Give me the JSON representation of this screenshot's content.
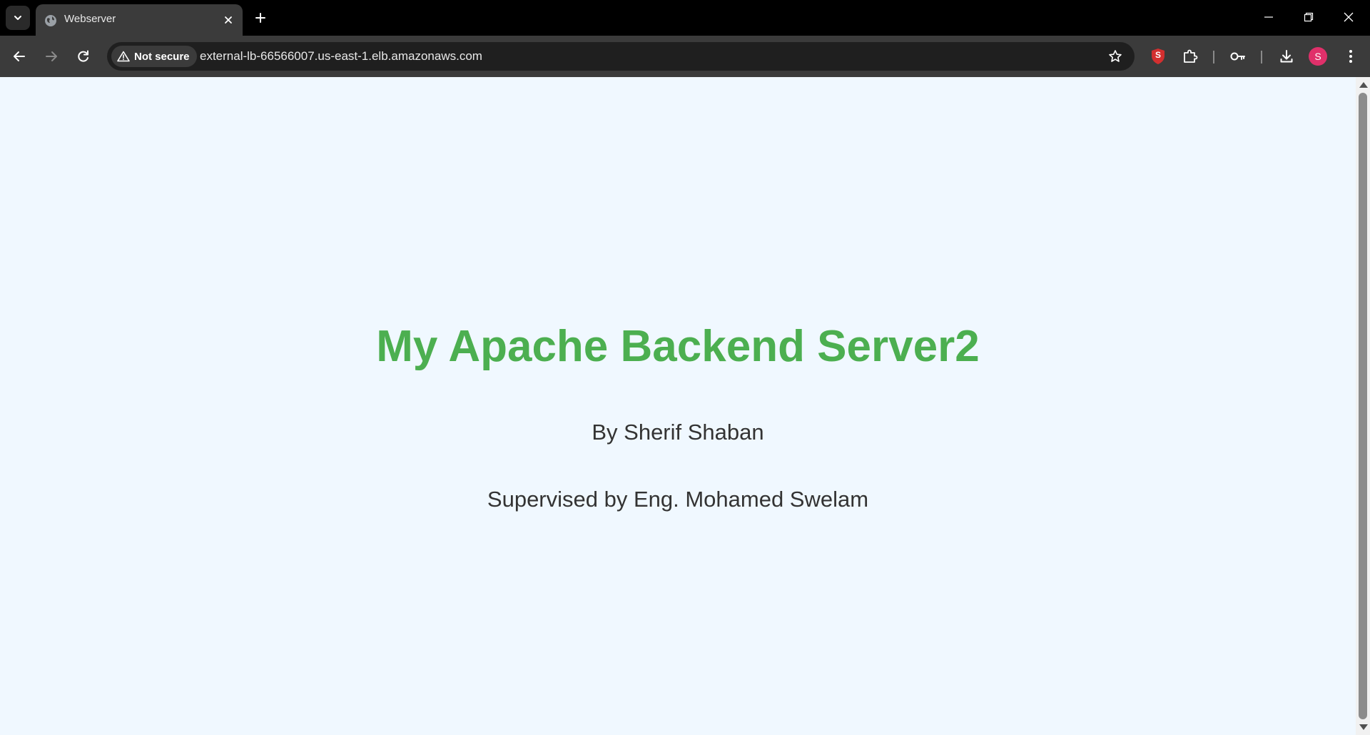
{
  "tab": {
    "title": "Webserver"
  },
  "address_bar": {
    "security_label": "Not secure",
    "url": "external-lb-66566007.us-east-1.elb.amazonaws.com"
  },
  "profile": {
    "initial": "S",
    "color": "#e0306a"
  },
  "extension": {
    "badge": "S",
    "color": "#d32f2f"
  },
  "page": {
    "heading": "My Apache Backend Server2",
    "author": "By Sherif Shaban",
    "supervisor": "Supervised by Eng. Mohamed Swelam",
    "heading_color": "#4caf50",
    "background_color": "#f0f8ff"
  }
}
